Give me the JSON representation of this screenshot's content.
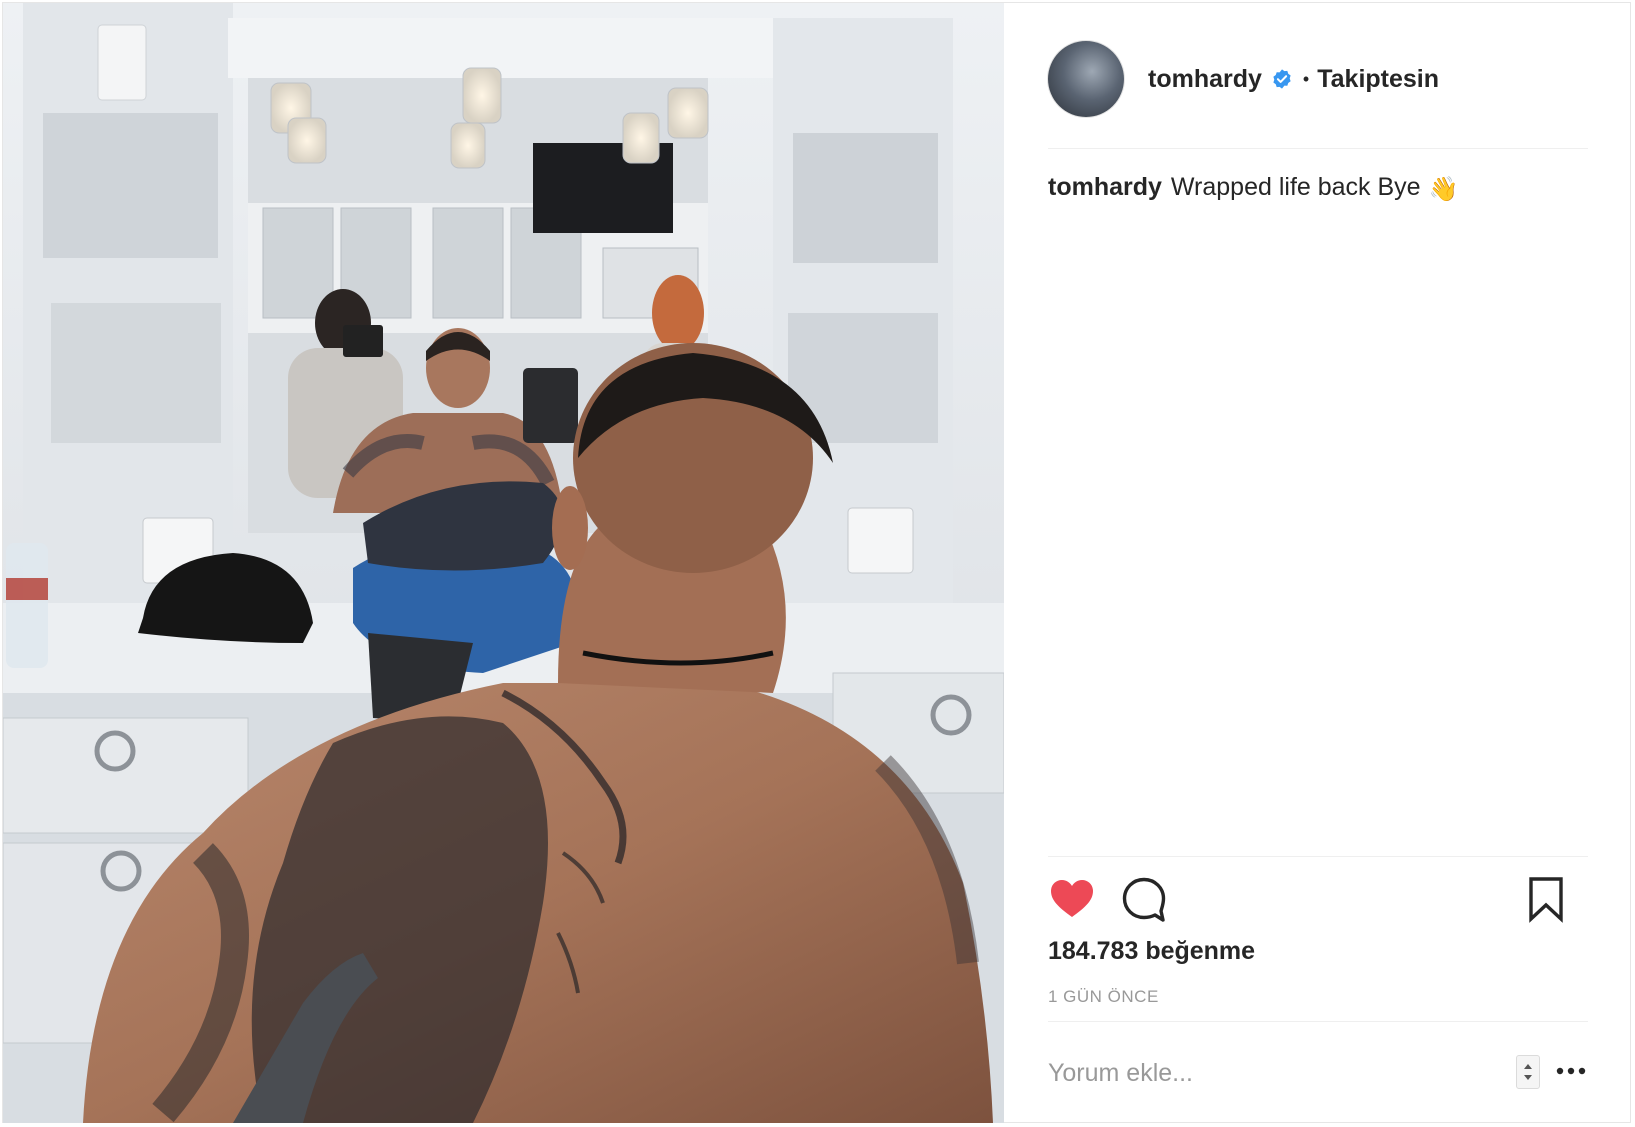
{
  "post": {
    "photo_alt": "",
    "header": {
      "username": "tomhardy",
      "separator": "•",
      "follow_status": "Takiptesin"
    },
    "caption": {
      "username": "tomhardy",
      "text": "Wrapped life back Bye",
      "emoji": "👋"
    },
    "actions": {
      "like_icon": "heart-icon",
      "like_color": "#ed4956",
      "comment_icon": "comment-icon",
      "save_icon": "bookmark-icon"
    },
    "likes": "184.783 beğenme",
    "time": "1 GÜN ÖNCE",
    "comment_placeholder": "Yorum ekle...",
    "more_icon": "more-options-icon",
    "verified_color": "#3897f0"
  }
}
